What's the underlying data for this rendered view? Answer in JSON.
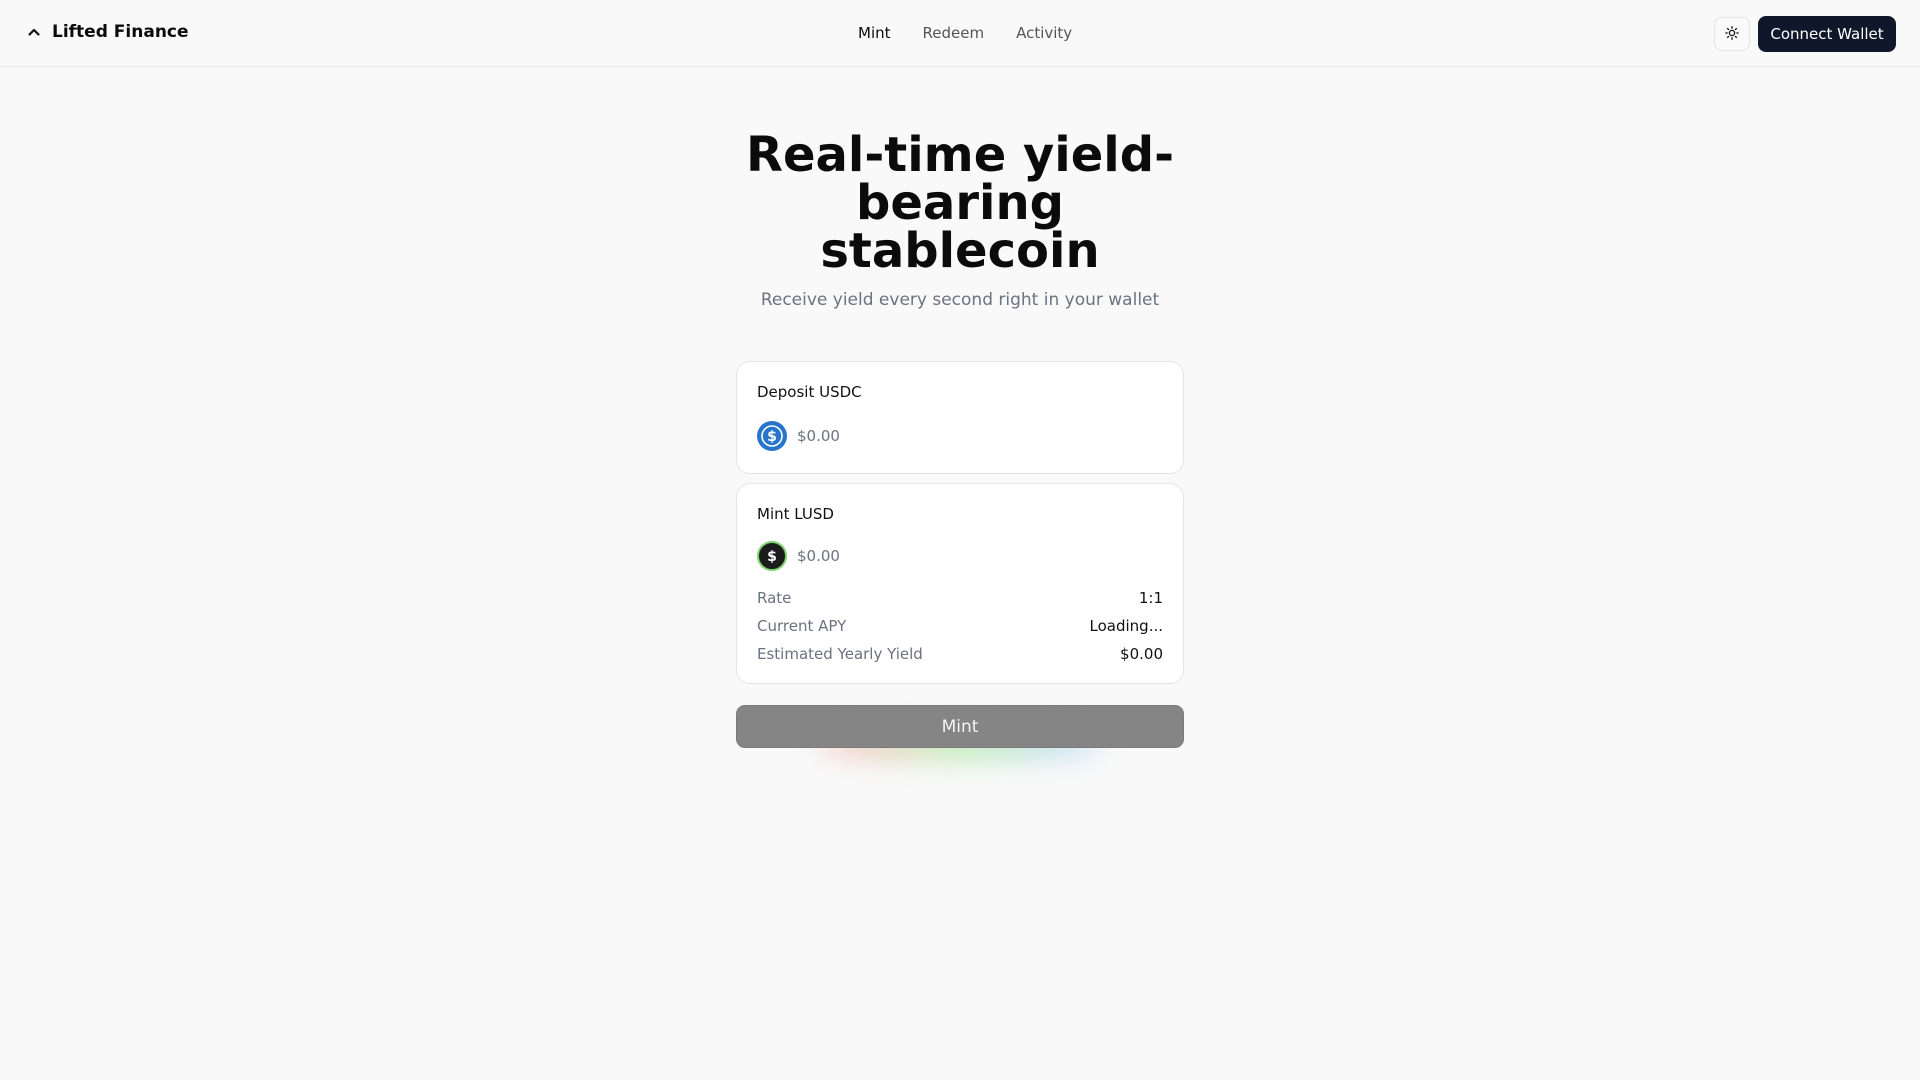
{
  "header": {
    "brand": "Lifted Finance",
    "brand_icon": "chevron-up-icon",
    "nav": [
      {
        "label": "Mint",
        "active": true
      },
      {
        "label": "Redeem",
        "active": false
      },
      {
        "label": "Activity",
        "active": false
      }
    ],
    "theme_icon": "sun-icon",
    "connect_label": "Connect Wallet"
  },
  "hero": {
    "title": "Real-time yield-bearing stablecoin",
    "subtitle": "Receive yield every second right in your wallet"
  },
  "deposit": {
    "label": "Deposit USDC",
    "icon": "usdc-coin-icon",
    "placeholder": "$0.00",
    "accent": "#2775ca"
  },
  "mint": {
    "label": "Mint LUSD",
    "icon": "lusd-coin-icon",
    "placeholder": "$0.00",
    "stats": [
      {
        "label": "Rate",
        "value": "1:1"
      },
      {
        "label": "Current APY",
        "value": "Loading..."
      },
      {
        "label": "Estimated Yearly Yield",
        "value": "$0.00"
      }
    ]
  },
  "action": {
    "mint_label": "Mint"
  }
}
